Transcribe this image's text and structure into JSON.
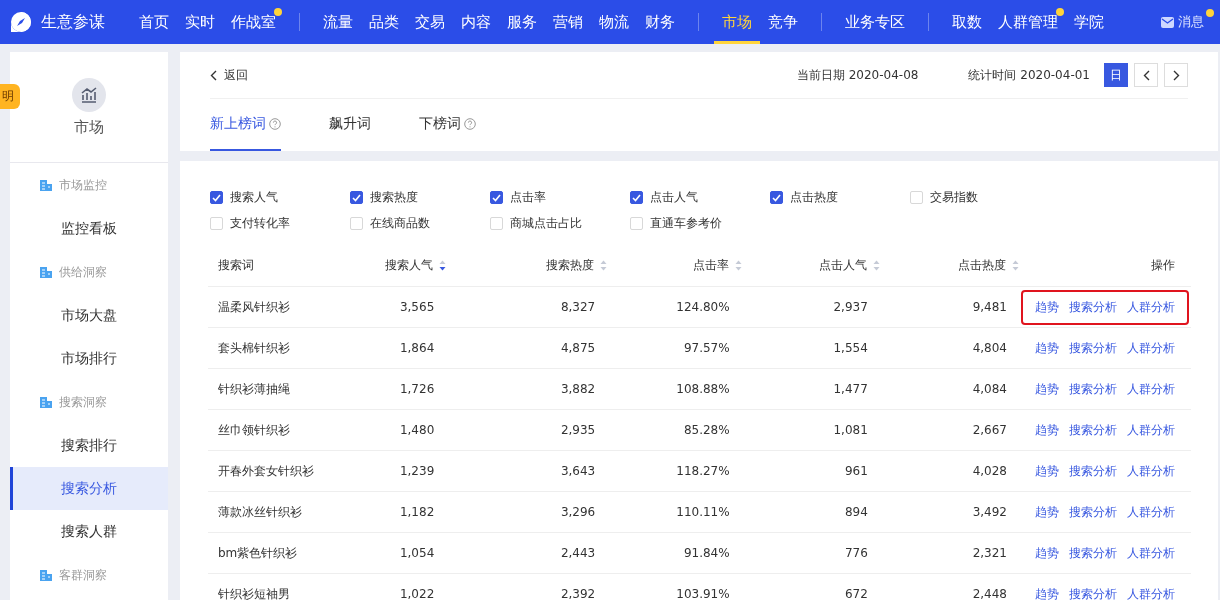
{
  "top_nav": {
    "brand": "生意参谋",
    "groups": [
      [
        {
          "label": "首页",
          "selected": false,
          "dot": false
        },
        {
          "label": "实时",
          "selected": false,
          "dot": false
        },
        {
          "label": "作战室",
          "selected": false,
          "dot": true
        }
      ],
      [
        {
          "label": "流量",
          "selected": false,
          "dot": false
        },
        {
          "label": "品类",
          "selected": false,
          "dot": false
        },
        {
          "label": "交易",
          "selected": false,
          "dot": false
        },
        {
          "label": "内容",
          "selected": false,
          "dot": false
        },
        {
          "label": "服务",
          "selected": false,
          "dot": false
        },
        {
          "label": "营销",
          "selected": false,
          "dot": false
        },
        {
          "label": "物流",
          "selected": false,
          "dot": false
        },
        {
          "label": "财务",
          "selected": false,
          "dot": false
        }
      ],
      [
        {
          "label": "市场",
          "selected": true,
          "dot": false
        },
        {
          "label": "竞争",
          "selected": false,
          "dot": false
        }
      ],
      [
        {
          "label": "业务专区",
          "selected": false,
          "dot": false
        }
      ],
      [
        {
          "label": "取数",
          "selected": false,
          "dot": false
        },
        {
          "label": "人群管理",
          "selected": false,
          "dot": true
        },
        {
          "label": "学院",
          "selected": false,
          "dot": false
        }
      ]
    ],
    "messages": {
      "label": "消息",
      "dot": true
    }
  },
  "side_tag": "明",
  "sidebar": {
    "title": "市场",
    "sections": [
      {
        "title": "市场监控",
        "items": [
          {
            "label": "监控看板",
            "selected": false
          }
        ]
      },
      {
        "title": "供给洞察",
        "items": [
          {
            "label": "市场大盘",
            "selected": false
          },
          {
            "label": "市场排行",
            "selected": false
          }
        ]
      },
      {
        "title": "搜索洞察",
        "items": [
          {
            "label": "搜索排行",
            "selected": false
          },
          {
            "label": "搜索分析",
            "selected": true
          },
          {
            "label": "搜索人群",
            "selected": false
          }
        ]
      },
      {
        "title": "客群洞察"
      }
    ]
  },
  "header": {
    "back": "返回",
    "current_date_label": "当前日期",
    "current_date": "2020-04-08",
    "stat_time_label": "统计时间",
    "stat_time": "2020-04-01",
    "period": "日",
    "tabs": [
      {
        "label": "新上榜词",
        "selected": true,
        "help": true
      },
      {
        "label": "飙升词",
        "selected": false,
        "help": false
      },
      {
        "label": "下榜词",
        "selected": false,
        "help": true
      }
    ]
  },
  "metrics": [
    {
      "label": "搜索人气",
      "checked": true
    },
    {
      "label": "搜索热度",
      "checked": true
    },
    {
      "label": "点击率",
      "checked": true
    },
    {
      "label": "点击人气",
      "checked": true
    },
    {
      "label": "点击热度",
      "checked": true
    },
    {
      "label": "交易指数",
      "checked": false
    },
    {
      "label": "支付转化率",
      "checked": false
    },
    {
      "label": "在线商品数",
      "checked": false
    },
    {
      "label": "商城点击占比",
      "checked": false
    },
    {
      "label": "直通车参考价",
      "checked": false
    }
  ],
  "table": {
    "columns": [
      {
        "label": "搜索词",
        "sortable": false
      },
      {
        "label": "搜索人气",
        "sortable": true,
        "sorted_desc": true
      },
      {
        "label": "搜索热度",
        "sortable": true,
        "sorted_desc": false
      },
      {
        "label": "点击率",
        "sortable": true,
        "sorted_desc": false
      },
      {
        "label": "点击人气",
        "sortable": true,
        "sorted_desc": false
      },
      {
        "label": "点击热度",
        "sortable": true,
        "sorted_desc": false
      },
      {
        "label": "操作",
        "sortable": false
      }
    ],
    "rows": [
      {
        "cells": [
          "温柔风针织衫",
          "3,565",
          "8,327",
          "124.80%",
          "2,937",
          "9,481"
        ],
        "actions": [
          "趋势",
          "搜索分析",
          "人群分析"
        ],
        "highlighted": true
      },
      {
        "cells": [
          "套头棉针织衫",
          "1,864",
          "4,875",
          "97.57%",
          "1,554",
          "4,804"
        ],
        "actions": [
          "趋势",
          "搜索分析",
          "人群分析"
        ],
        "highlighted": false
      },
      {
        "cells": [
          "针织衫薄抽绳",
          "1,726",
          "3,882",
          "108.88%",
          "1,477",
          "4,084"
        ],
        "actions": [
          "趋势",
          "搜索分析",
          "人群分析"
        ],
        "highlighted": false
      },
      {
        "cells": [
          "丝巾领针织衫",
          "1,480",
          "2,935",
          "85.28%",
          "1,081",
          "2,667"
        ],
        "actions": [
          "趋势",
          "搜索分析",
          "人群分析"
        ],
        "highlighted": false
      },
      {
        "cells": [
          "开春外套女针织衫",
          "1,239",
          "3,643",
          "118.27%",
          "961",
          "4,028"
        ],
        "actions": [
          "趋势",
          "搜索分析",
          "人群分析"
        ],
        "highlighted": false
      },
      {
        "cells": [
          "薄款冰丝针织衫",
          "1,182",
          "3,296",
          "110.11%",
          "894",
          "3,492"
        ],
        "actions": [
          "趋势",
          "搜索分析",
          "人群分析"
        ],
        "highlighted": false
      },
      {
        "cells": [
          "bm紫色针织衫",
          "1,054",
          "2,443",
          "91.84%",
          "776",
          "2,321"
        ],
        "actions": [
          "趋势",
          "搜索分析",
          "人群分析"
        ],
        "highlighted": false
      },
      {
        "cells": [
          "针织衫短袖男",
          "1,022",
          "2,392",
          "103.91%",
          "672",
          "2,448"
        ],
        "actions": [
          "趋势",
          "搜索分析",
          "人群分析"
        ],
        "highlighted": false
      }
    ]
  }
}
